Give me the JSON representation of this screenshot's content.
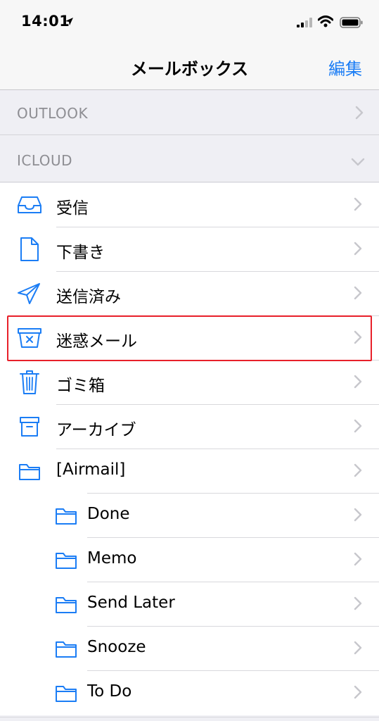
{
  "status_bar": {
    "time": "14:01",
    "icons": [
      "location-arrow-icon",
      "cellular-signal-icon",
      "wifi-icon",
      "battery-icon"
    ]
  },
  "navbar": {
    "title": "メールボックス",
    "edit_label": "編集"
  },
  "accounts": {
    "outlook": {
      "label": "OUTLOOK",
      "expanded": false
    },
    "icloud": {
      "label": "ICLOUD",
      "expanded": true
    }
  },
  "mailboxes": [
    {
      "label": "受信",
      "icon": "inbox-tray-icon"
    },
    {
      "label": "下書き",
      "icon": "document-icon"
    },
    {
      "label": "送信済み",
      "icon": "paper-plane-icon"
    },
    {
      "label": "迷惑メール",
      "icon": "junk-box-icon",
      "highlighted": true
    },
    {
      "label": "ゴミ箱",
      "icon": "trash-can-icon"
    },
    {
      "label": "アーカイブ",
      "icon": "archive-box-icon"
    },
    {
      "label": "[Airmail]",
      "icon": "folder-icon"
    },
    {
      "label": "Done",
      "icon": "folder-icon",
      "nested": true
    },
    {
      "label": "Memo",
      "icon": "folder-icon",
      "nested": true
    },
    {
      "label": "Send Later",
      "icon": "folder-icon",
      "nested": true
    },
    {
      "label": "Snooze",
      "icon": "folder-icon",
      "nested": true
    },
    {
      "label": "To Do",
      "icon": "folder-icon",
      "nested": true
    }
  ],
  "colors": {
    "accent": "#1b7df5",
    "highlight": "#e8202a",
    "section_text": "#8e8e93",
    "chevron": "#c7c7cc"
  }
}
